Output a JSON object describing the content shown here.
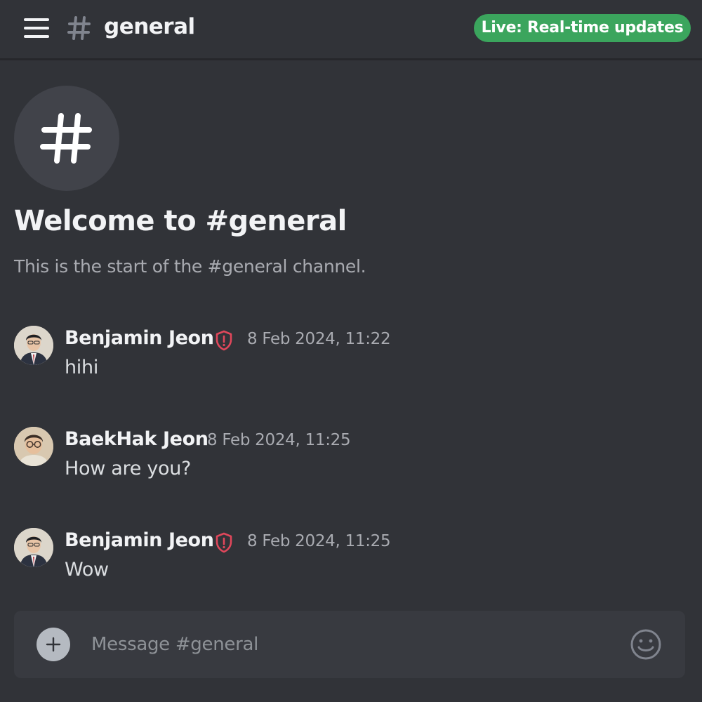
{
  "header": {
    "channel_name": "general",
    "live_badge": "Live: Real-time updates"
  },
  "welcome": {
    "title": "Welcome to #general",
    "subtitle": "This is the start of the #general channel."
  },
  "messages": [
    {
      "author": "Benjamin Jeon",
      "badge_icon": "shield-alert-icon",
      "time": "8 Feb 2024, 11:22",
      "text": "hihi"
    },
    {
      "author": "BaekHak Jeon",
      "time": "8 Feb 2024, 11:25",
      "text": "How are you?"
    },
    {
      "author": "Benjamin Jeon",
      "badge_icon": "shield-alert-icon",
      "time": "8 Feb 2024, 11:25",
      "text": "Wow"
    }
  ],
  "composer": {
    "placeholder": "Message #general"
  },
  "colors": {
    "background": "#313338",
    "live_badge": "#3ba55d",
    "shield": "#e0475b",
    "composer": "#383a40"
  }
}
